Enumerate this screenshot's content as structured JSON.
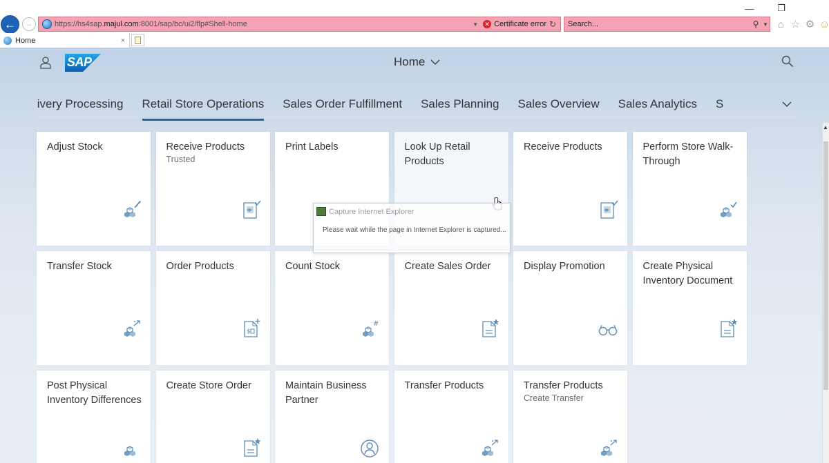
{
  "browser": {
    "url_prefix": "https://hs4sap.",
    "url_domain": "majul.com",
    "url_suffix": ":8001/sap/bc/ui2/flp#Shell-home",
    "certificate_error": "Certificate error",
    "search_placeholder": "Search...",
    "tab_title": "Home",
    "tab_close": "×"
  },
  "shell": {
    "logo": "SAP",
    "title": "Home"
  },
  "anchor_bar": {
    "items": [
      "livery Processing",
      "Retail Store Operations",
      "Sales Order Fulfillment",
      "Sales Planning",
      "Sales Overview",
      "Sales Analytics",
      "S"
    ],
    "selected": "Retail Store Operations"
  },
  "tiles": [
    {
      "title": "Adjust Stock",
      "subtitle": "",
      "icon": "cubes-wand-icon"
    },
    {
      "title": "Receive Products",
      "subtitle": "Trusted",
      "icon": "document-check-icon"
    },
    {
      "title": "Print Labels",
      "subtitle": "",
      "icon": "printer-icon"
    },
    {
      "title": "Look Up Retail Products",
      "subtitle": "",
      "icon": "search-products-icon"
    },
    {
      "title": "Receive Products",
      "subtitle": "",
      "icon": "document-check-icon"
    },
    {
      "title": "Perform Store Walk-Through",
      "subtitle": "",
      "icon": "cubes-check-icon"
    },
    {
      "title": "Transfer Stock",
      "subtitle": "",
      "icon": "cubes-arrows-icon"
    },
    {
      "title": "Order Products",
      "subtitle": "",
      "icon": "document-money-plus-icon"
    },
    {
      "title": "Count Stock",
      "subtitle": "",
      "icon": "cubes-hash-icon"
    },
    {
      "title": "Create Sales Order",
      "subtitle": "",
      "icon": "document-star-icon"
    },
    {
      "title": "Display Promotion",
      "subtitle": "",
      "icon": "glasses-icon"
    },
    {
      "title": "Create Physical Inventory Document",
      "subtitle": "",
      "icon": "document-star-icon"
    },
    {
      "title": "Post Physical Inventory Differences",
      "subtitle": "",
      "icon": "cubes-icon"
    },
    {
      "title": "Create Store Order",
      "subtitle": "",
      "icon": "document-star-icon"
    },
    {
      "title": "Maintain Business Partner",
      "subtitle": "",
      "icon": "person-circle-icon"
    },
    {
      "title": "Transfer Products",
      "subtitle": "",
      "icon": "cubes-arrows-icon"
    },
    {
      "title": "Transfer Products",
      "subtitle": "Create Transfer",
      "icon": "cubes-arrows-icon"
    }
  ],
  "capture_dialog": {
    "title": "Capture Internet Explorer",
    "message": "Please wait while the page in Internet Explorer is captured..."
  },
  "colors": {
    "address_bar_error": "#f3a3b1",
    "sap_blue": "#1a73c8",
    "selected_tab_underline": "#346187",
    "icon_color": "#5b8db8"
  }
}
